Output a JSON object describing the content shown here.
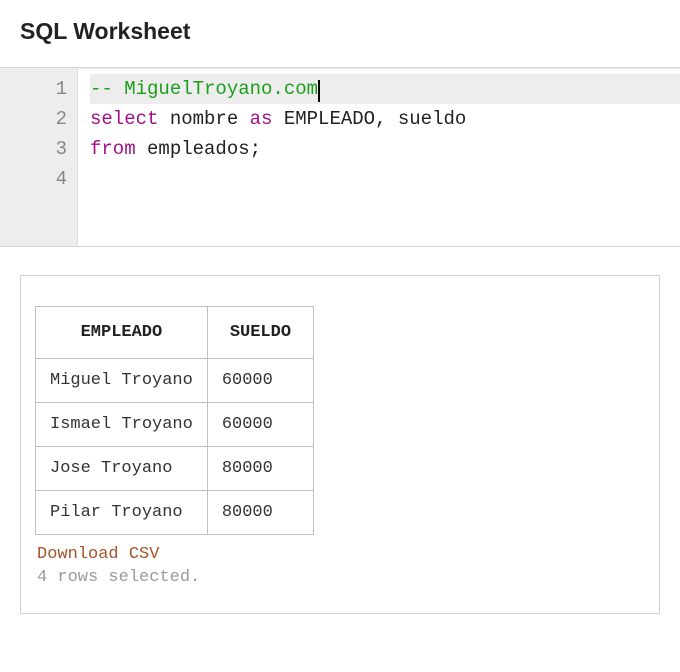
{
  "header": {
    "title": "SQL Worksheet"
  },
  "editor": {
    "lines": [
      {
        "num": "1",
        "highlight": true,
        "tokens": [
          {
            "t": "-- MiguelTroyano.com",
            "c": "tok-comment"
          }
        ],
        "cursor": true
      },
      {
        "num": "2",
        "highlight": false,
        "tokens": [
          {
            "t": "select",
            "c": "tok-kw"
          },
          {
            "t": " nombre ",
            "c": "tok-id"
          },
          {
            "t": "as",
            "c": "tok-kw"
          },
          {
            "t": " EMPLEADO, sueldo",
            "c": "tok-id"
          }
        ]
      },
      {
        "num": "3",
        "highlight": false,
        "tokens": [
          {
            "t": "from",
            "c": "tok-kw"
          },
          {
            "t": " empleados;",
            "c": "tok-id"
          }
        ]
      },
      {
        "num": "4",
        "highlight": false,
        "tokens": []
      }
    ]
  },
  "results": {
    "columns": [
      "EMPLEADO",
      "SUELDO"
    ],
    "rows": [
      [
        "Miguel Troyano",
        "60000"
      ],
      [
        "Ismael Troyano",
        "60000"
      ],
      [
        "Jose Troyano",
        "80000"
      ],
      [
        "Pilar Troyano",
        "80000"
      ]
    ],
    "download_label": "Download CSV",
    "status": "4 rows selected."
  }
}
